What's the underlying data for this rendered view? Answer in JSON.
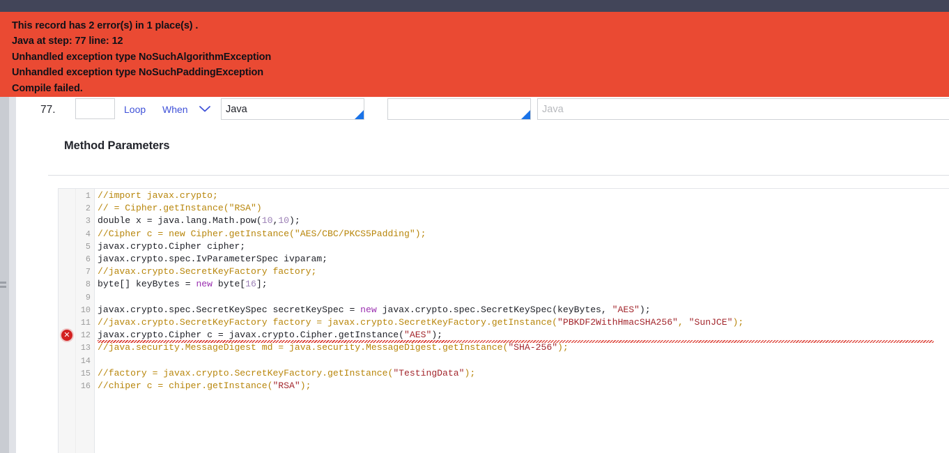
{
  "colors": {
    "topbar": "#424559",
    "error_banner": "#ea4a33",
    "accent_link": "#3f51d8",
    "grip_blue": "#1a73e8",
    "error_red": "#d32020",
    "comment": "#b8860b",
    "string": "#a3272d",
    "keyword": "#9b30b0"
  },
  "error_banner": {
    "lines": [
      "This record has 2 error(s) in 1 place(s) .",
      "Java at step: 77 line: 12",
      "Unhandled exception type NoSuchAlgorithmException",
      "Unhandled exception type NoSuchPaddingException",
      "Compile failed."
    ]
  },
  "step_row": {
    "step_number": "77.",
    "step_input_value": "",
    "loop_label": "Loop",
    "when_label": "When",
    "chevron_icon": "chevron-down-icon",
    "language_select_value": "Java",
    "second_select_value": "",
    "code_summary_placeholder": "Java",
    "code_summary_value": ""
  },
  "panel": {
    "title": "Method Parameters"
  },
  "editor": {
    "error_marker_icon": "error-circle-x-icon",
    "error_marker_line": 12,
    "lines": [
      {
        "n": 1,
        "tokens": [
          {
            "t": "//import javax.crypto;",
            "c": "cmt"
          }
        ]
      },
      {
        "n": 2,
        "tokens": [
          {
            "t": "// = Cipher.getInstance(\"RSA\")",
            "c": "cmt"
          }
        ]
      },
      {
        "n": 3,
        "tokens": [
          {
            "t": "double x = java.lang.Math.pow(",
            "c": ""
          },
          {
            "t": "10",
            "c": "num"
          },
          {
            "t": ",",
            "c": ""
          },
          {
            "t": "10",
            "c": "num"
          },
          {
            "t": ");",
            "c": ""
          }
        ]
      },
      {
        "n": 4,
        "tokens": [
          {
            "t": "//Cipher c = new Cipher.getInstance(\"AES/CBC/PKCS5Padding\");",
            "c": "cmt"
          }
        ]
      },
      {
        "n": 5,
        "tokens": [
          {
            "t": "javax.crypto.Cipher cipher;",
            "c": ""
          }
        ]
      },
      {
        "n": 6,
        "tokens": [
          {
            "t": "javax.crypto.spec.IvParameterSpec ivparam;",
            "c": ""
          }
        ]
      },
      {
        "n": 7,
        "tokens": [
          {
            "t": "//javax.crypto.SecretKeyFactory factory;",
            "c": "cmt"
          }
        ]
      },
      {
        "n": 8,
        "tokens": [
          {
            "t": "byte[] keyBytes = ",
            "c": ""
          },
          {
            "t": "new",
            "c": "kw"
          },
          {
            "t": " byte[",
            "c": ""
          },
          {
            "t": "16",
            "c": "num"
          },
          {
            "t": "];",
            "c": ""
          }
        ]
      },
      {
        "n": 9,
        "tokens": [
          {
            "t": "",
            "c": ""
          }
        ]
      },
      {
        "n": 10,
        "tokens": [
          {
            "t": "javax.crypto.spec.SecretKeySpec secretKeySpec = ",
            "c": ""
          },
          {
            "t": "new",
            "c": "kw"
          },
          {
            "t": " javax.crypto.spec.SecretKeySpec(keyBytes, ",
            "c": ""
          },
          {
            "t": "\"AES\"",
            "c": "str"
          },
          {
            "t": ");",
            "c": ""
          }
        ]
      },
      {
        "n": 11,
        "tokens": [
          {
            "t": "//javax.crypto.SecretKeyFactory factory = javax.crypto.SecretKeyFactory.getInstance(",
            "c": "cmt"
          },
          {
            "t": "\"PBKDF2WithHmacSHA256\"",
            "c": "str"
          },
          {
            "t": ", ",
            "c": "cmt"
          },
          {
            "t": "\"SunJCE\"",
            "c": "str"
          },
          {
            "t": ");",
            "c": "cmt"
          }
        ]
      },
      {
        "n": 12,
        "tokens": [
          {
            "t": "javax.crypto.Cipher c = javax.crypto.Cipher.getInstance(",
            "c": ""
          },
          {
            "t": "\"AES\"",
            "c": "str"
          },
          {
            "t": ");",
            "c": ""
          }
        ]
      },
      {
        "n": 13,
        "tokens": [
          {
            "t": "//java.security.MessageDigest md = java.security.MessageDigest.getInstance(",
            "c": "cmt"
          },
          {
            "t": "\"SHA-256\"",
            "c": "str"
          },
          {
            "t": ");",
            "c": "cmt"
          }
        ]
      },
      {
        "n": 14,
        "tokens": [
          {
            "t": "",
            "c": ""
          }
        ]
      },
      {
        "n": 15,
        "tokens": [
          {
            "t": "//factory = javax.crypto.SecretKeyFactory.getInstance(",
            "c": "cmt"
          },
          {
            "t": "\"TestingData\"",
            "c": "str"
          },
          {
            "t": ");",
            "c": "cmt"
          }
        ]
      },
      {
        "n": 16,
        "tokens": [
          {
            "t": "//chiper c = chiper.getInstance(",
            "c": "cmt"
          },
          {
            "t": "\"RSA\"",
            "c": "str"
          },
          {
            "t": ");",
            "c": "cmt"
          }
        ]
      }
    ]
  }
}
